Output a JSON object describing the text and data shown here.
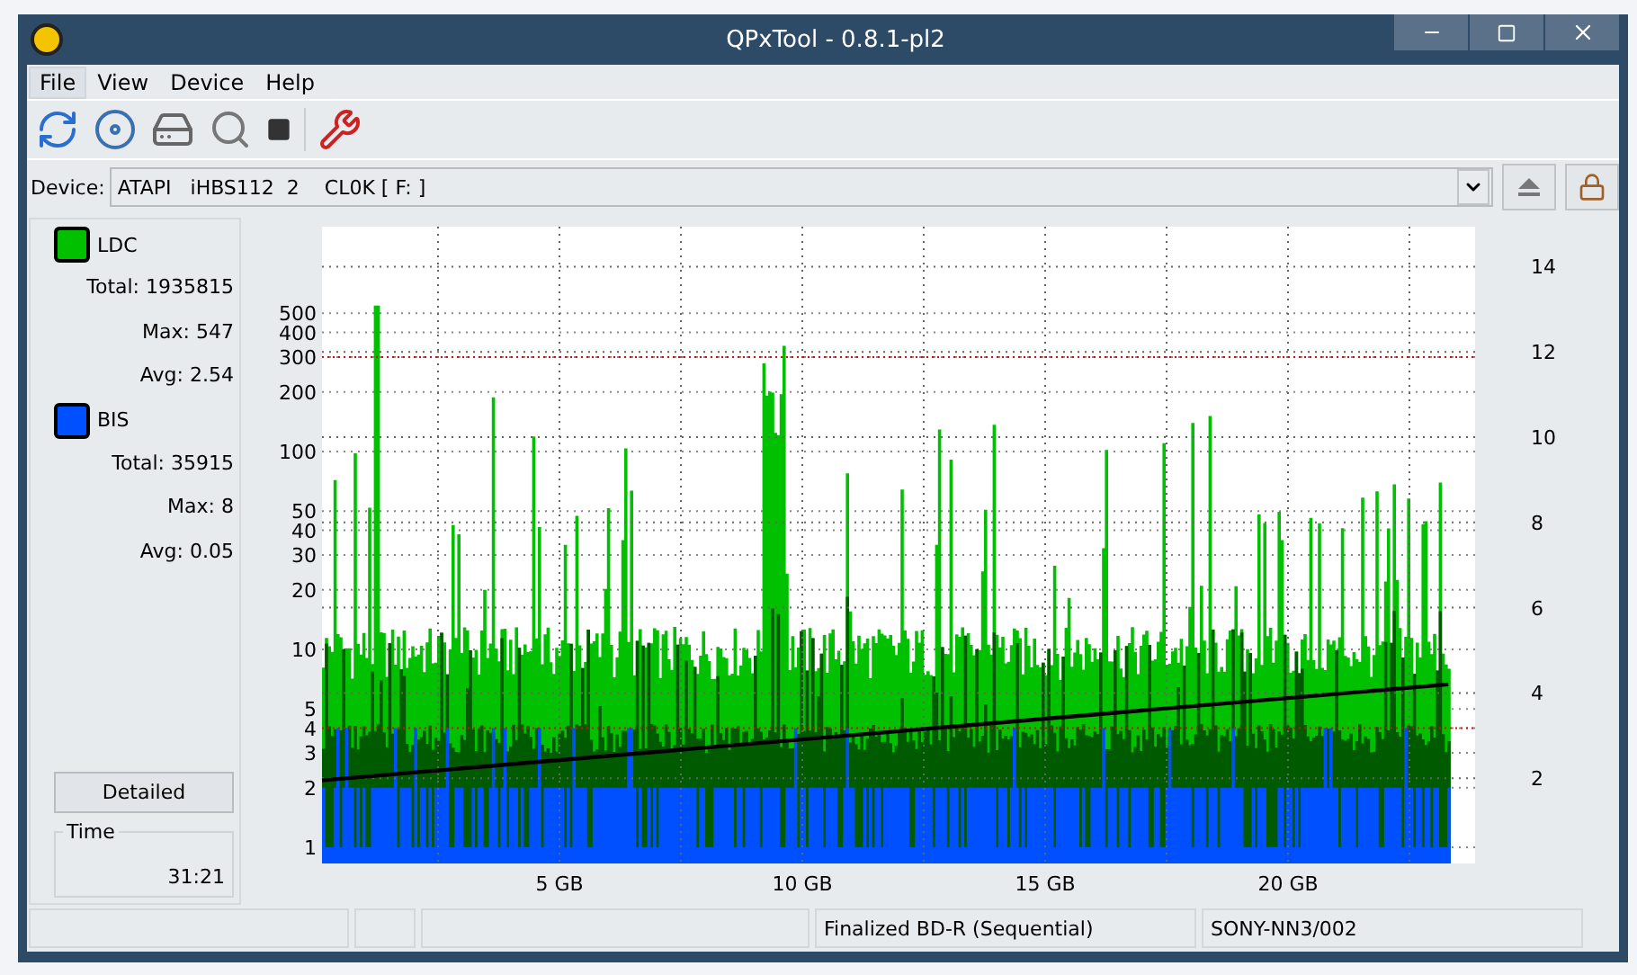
{
  "window": {
    "title": "QPxTool - 0.8.1-pl2"
  },
  "menu": [
    {
      "label": "File",
      "selected": true
    },
    {
      "label": "View",
      "selected": false
    },
    {
      "label": "Device",
      "selected": false
    },
    {
      "label": "Help",
      "selected": false
    }
  ],
  "device": {
    "label": "Device:",
    "value": "ATAPI   iHBS112  2    CL0K [ F: ]"
  },
  "legend": [
    {
      "name": "LDC",
      "color": "#00c000",
      "stats": [
        "Total: 1935815",
        "Max: 547",
        "Avg: 2.54"
      ]
    },
    {
      "name": "BIS",
      "color": "#0050ff",
      "stats": [
        "Total: 35915",
        "Max: 8",
        "Avg: 0.05"
      ]
    }
  ],
  "detailed_button": "Detailed",
  "time": {
    "label": "Time",
    "value": "31:21"
  },
  "chart": {
    "y_left_ticks": [
      "500",
      "400",
      "300",
      "200",
      "100",
      "50",
      "40",
      "30",
      "20",
      "10",
      "5",
      "4",
      "3",
      "2",
      "1"
    ],
    "y_right_ticks": [
      "14",
      "12",
      "10",
      "8",
      "6",
      "4",
      "2"
    ],
    "x_ticks": [
      "5 GB",
      "10 GB",
      "15 GB",
      "20 GB"
    ]
  },
  "status_bar": [
    "Finalized BD-R (Sequential)",
    "SONY-NN3/002"
  ]
}
